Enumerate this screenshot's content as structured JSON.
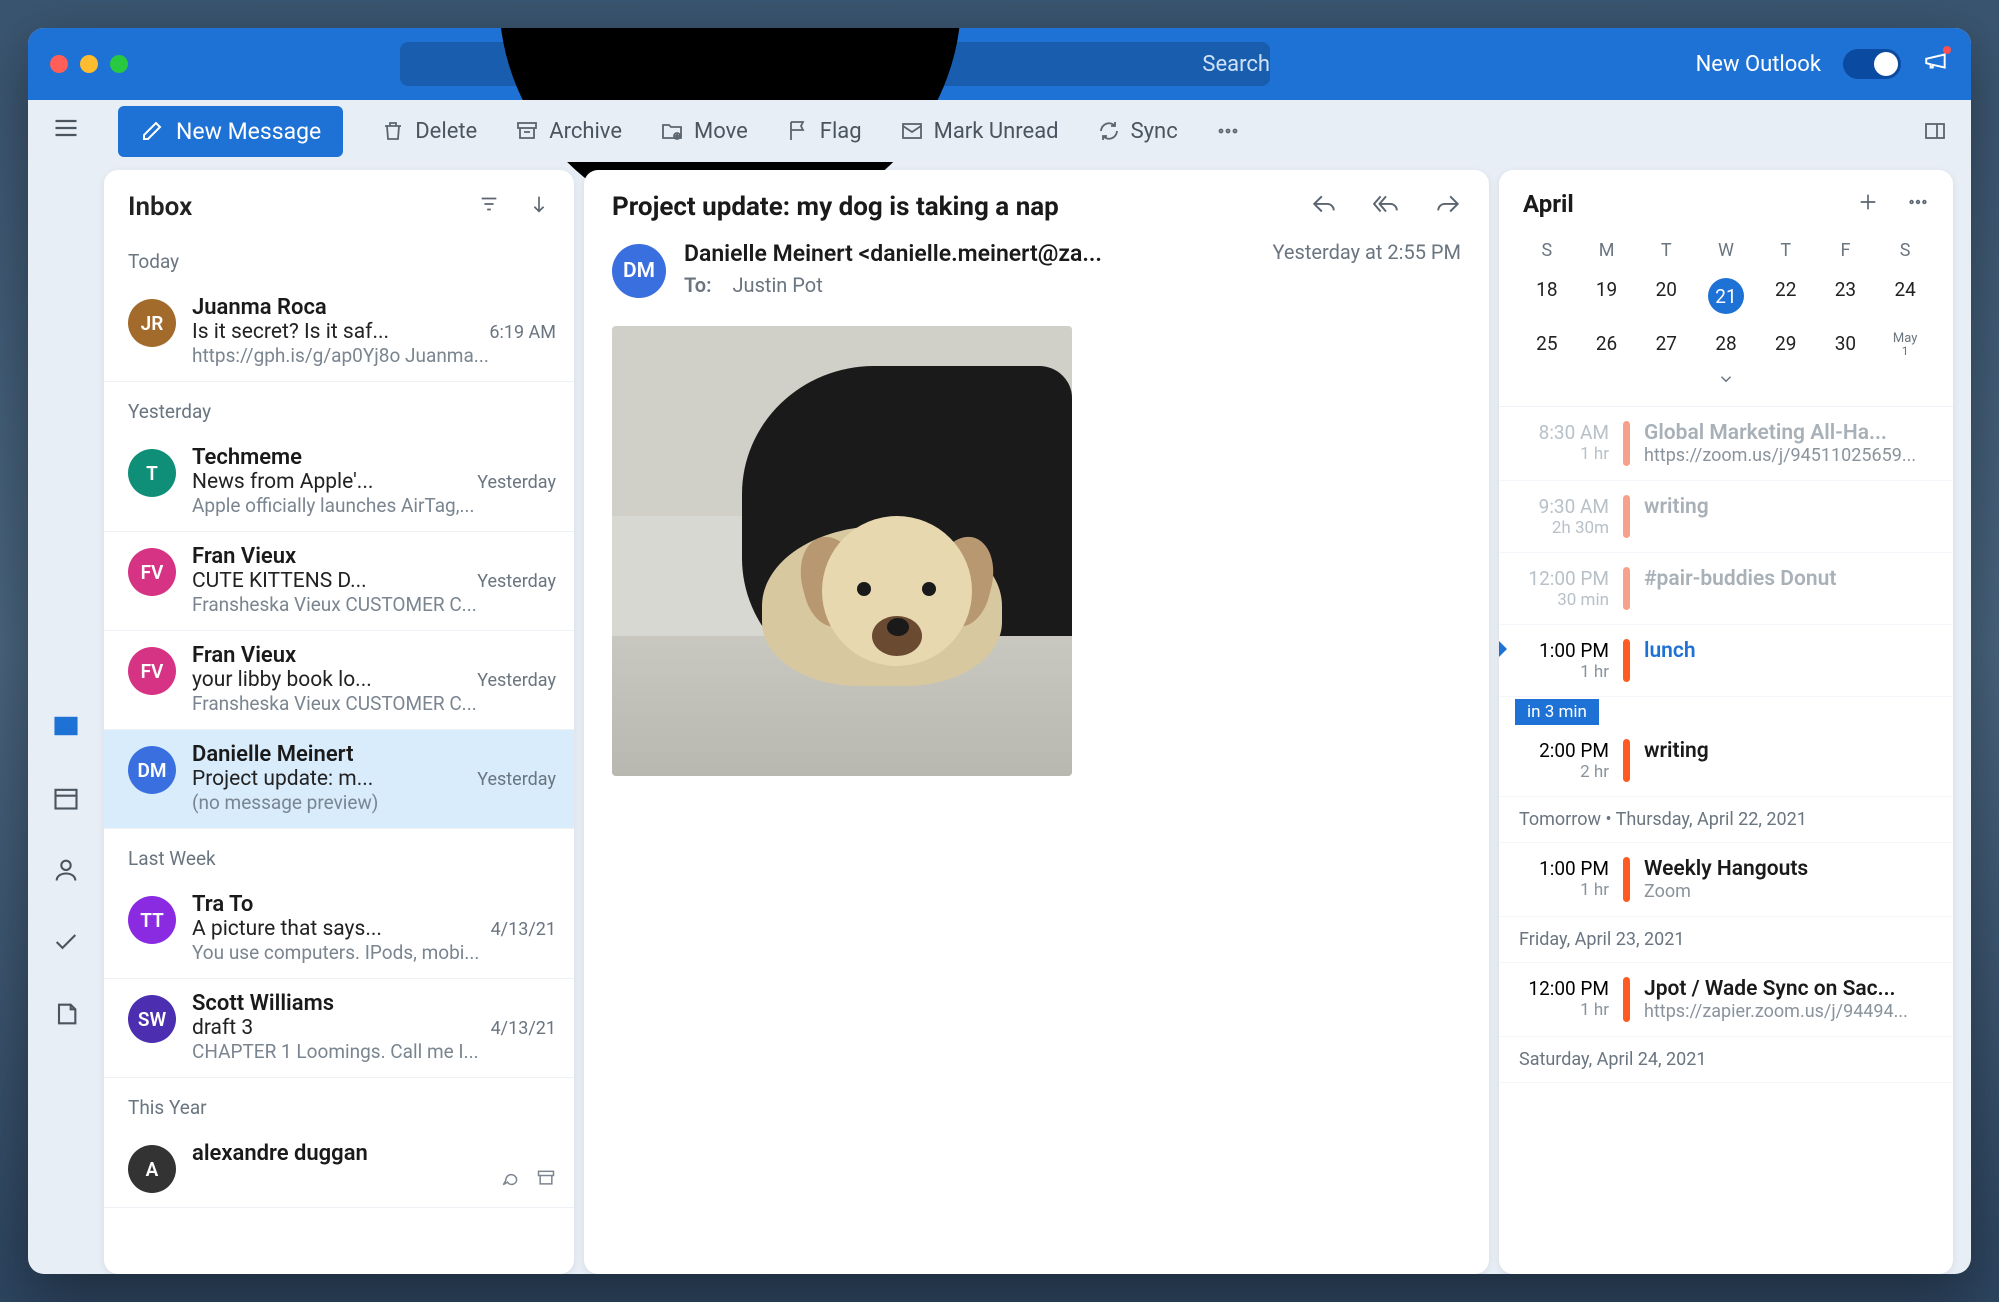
{
  "titlebar": {
    "search_placeholder": "Search",
    "new_outlook_label": "New Outlook"
  },
  "toolbar": {
    "new_message": "New Message",
    "delete": "Delete",
    "archive": "Archive",
    "move": "Move",
    "flag": "Flag",
    "mark_unread": "Mark Unread",
    "sync": "Sync"
  },
  "list": {
    "title": "Inbox",
    "sections": [
      {
        "label": "Today",
        "items": [
          {
            "initials": "JR",
            "color": "#a36b2b",
            "from": "Juanma Roca",
            "subject": "Is it secret? Is it saf...",
            "date": "6:19 AM",
            "preview": "https://gph.is/g/ap0Yj8o Juanma..."
          }
        ]
      },
      {
        "label": "Yesterday",
        "items": [
          {
            "initials": "T",
            "color": "#0f8f78",
            "from": "Techmeme",
            "subject": "News from Apple'...",
            "date": "Yesterday",
            "preview": "Apple officially launches AirTag,..."
          },
          {
            "initials": "FV",
            "color": "#d63384",
            "from": "Fran Vieux",
            "subject": "CUTE KITTENS D...",
            "date": "Yesterday",
            "preview": "Fransheska Vieux CUSTOMER C..."
          },
          {
            "initials": "FV",
            "color": "#d63384",
            "from": "Fran Vieux",
            "subject": "your libby book lo...",
            "date": "Yesterday",
            "preview": "Fransheska Vieux CUSTOMER C..."
          },
          {
            "initials": "DM",
            "color": "#3a6fe0",
            "from": "Danielle Meinert",
            "subject": "Project update: m...",
            "date": "Yesterday",
            "preview": "(no message preview)",
            "selected": true
          }
        ]
      },
      {
        "label": "Last Week",
        "items": [
          {
            "initials": "TT",
            "color": "#8a2be2",
            "from": "Tra To",
            "subject": "A picture that says...",
            "date": "4/13/21",
            "preview": "You use computers. IPods, mobi..."
          },
          {
            "initials": "SW",
            "color": "#4b2fb0",
            "from": "Scott Williams",
            "subject": "draft 3",
            "date": "4/13/21",
            "preview": "CHAPTER 1 Loomings. Call me I..."
          }
        ]
      },
      {
        "label": "This Year",
        "items": [
          {
            "initials": "A",
            "color": "#333",
            "from": "alexandre duggan",
            "subject": "",
            "date": "",
            "preview": "",
            "truncated": true
          }
        ]
      }
    ]
  },
  "reader": {
    "subject": "Project update: my dog is taking a nap",
    "avatar_initials": "DM",
    "avatar_color": "#3a6fe0",
    "from": "Danielle Meinert <danielle.meinert@za...",
    "to_label": "To:",
    "to": "Justin Pot",
    "date": "Yesterday at 2:55 PM"
  },
  "calendar": {
    "month": "April",
    "dow": [
      "S",
      "M",
      "T",
      "W",
      "T",
      "F",
      "S"
    ],
    "weeks": [
      [
        "18",
        "19",
        "20",
        "21",
        "22",
        "23",
        "24"
      ],
      [
        "25",
        "26",
        "27",
        "28",
        "29",
        "30",
        "May1"
      ]
    ],
    "today": "21",
    "chip": "in 3 min",
    "separators": {
      "tomorrow": "Tomorrow  •  Thursday, April 22, 2021",
      "friday": "Friday, April 23, 2021",
      "saturday": "Saturday, April 24, 2021"
    },
    "events": [
      {
        "time": "8:30 AM",
        "dur": "1 hr",
        "bar": "#f7a18a",
        "title": "Global Marketing All-Ha...",
        "sub": "https://zoom.us/j/94511025659...",
        "state": "past"
      },
      {
        "time": "9:30 AM",
        "dur": "2h 30m",
        "bar": "#f7a18a",
        "title": "writing",
        "sub": "",
        "state": "past"
      },
      {
        "time": "12:00 PM",
        "dur": "30 min",
        "bar": "#f7a18a",
        "title": "#pair-buddies Donut",
        "sub": "",
        "state": "past"
      },
      {
        "time": "1:00 PM",
        "dur": "1 hr",
        "bar": "#ff5a1f",
        "title": "lunch",
        "sub": "",
        "state": "current"
      },
      {
        "time": "2:00 PM",
        "dur": "2 hr",
        "bar": "#ff5a1f",
        "title": "writing",
        "sub": "",
        "state": ""
      },
      {
        "sep": "tomorrow"
      },
      {
        "time": "1:00 PM",
        "dur": "1 hr",
        "bar": "#ff5a1f",
        "title": "Weekly Hangouts",
        "sub": "Zoom",
        "state": ""
      },
      {
        "sep": "friday"
      },
      {
        "time": "12:00 PM",
        "dur": "1 hr",
        "bar": "#ff5a1f",
        "title": "Jpot / Wade Sync on Sac...",
        "sub": "https://zapier.zoom.us/j/94494...",
        "state": ""
      },
      {
        "sep": "saturday"
      }
    ]
  }
}
